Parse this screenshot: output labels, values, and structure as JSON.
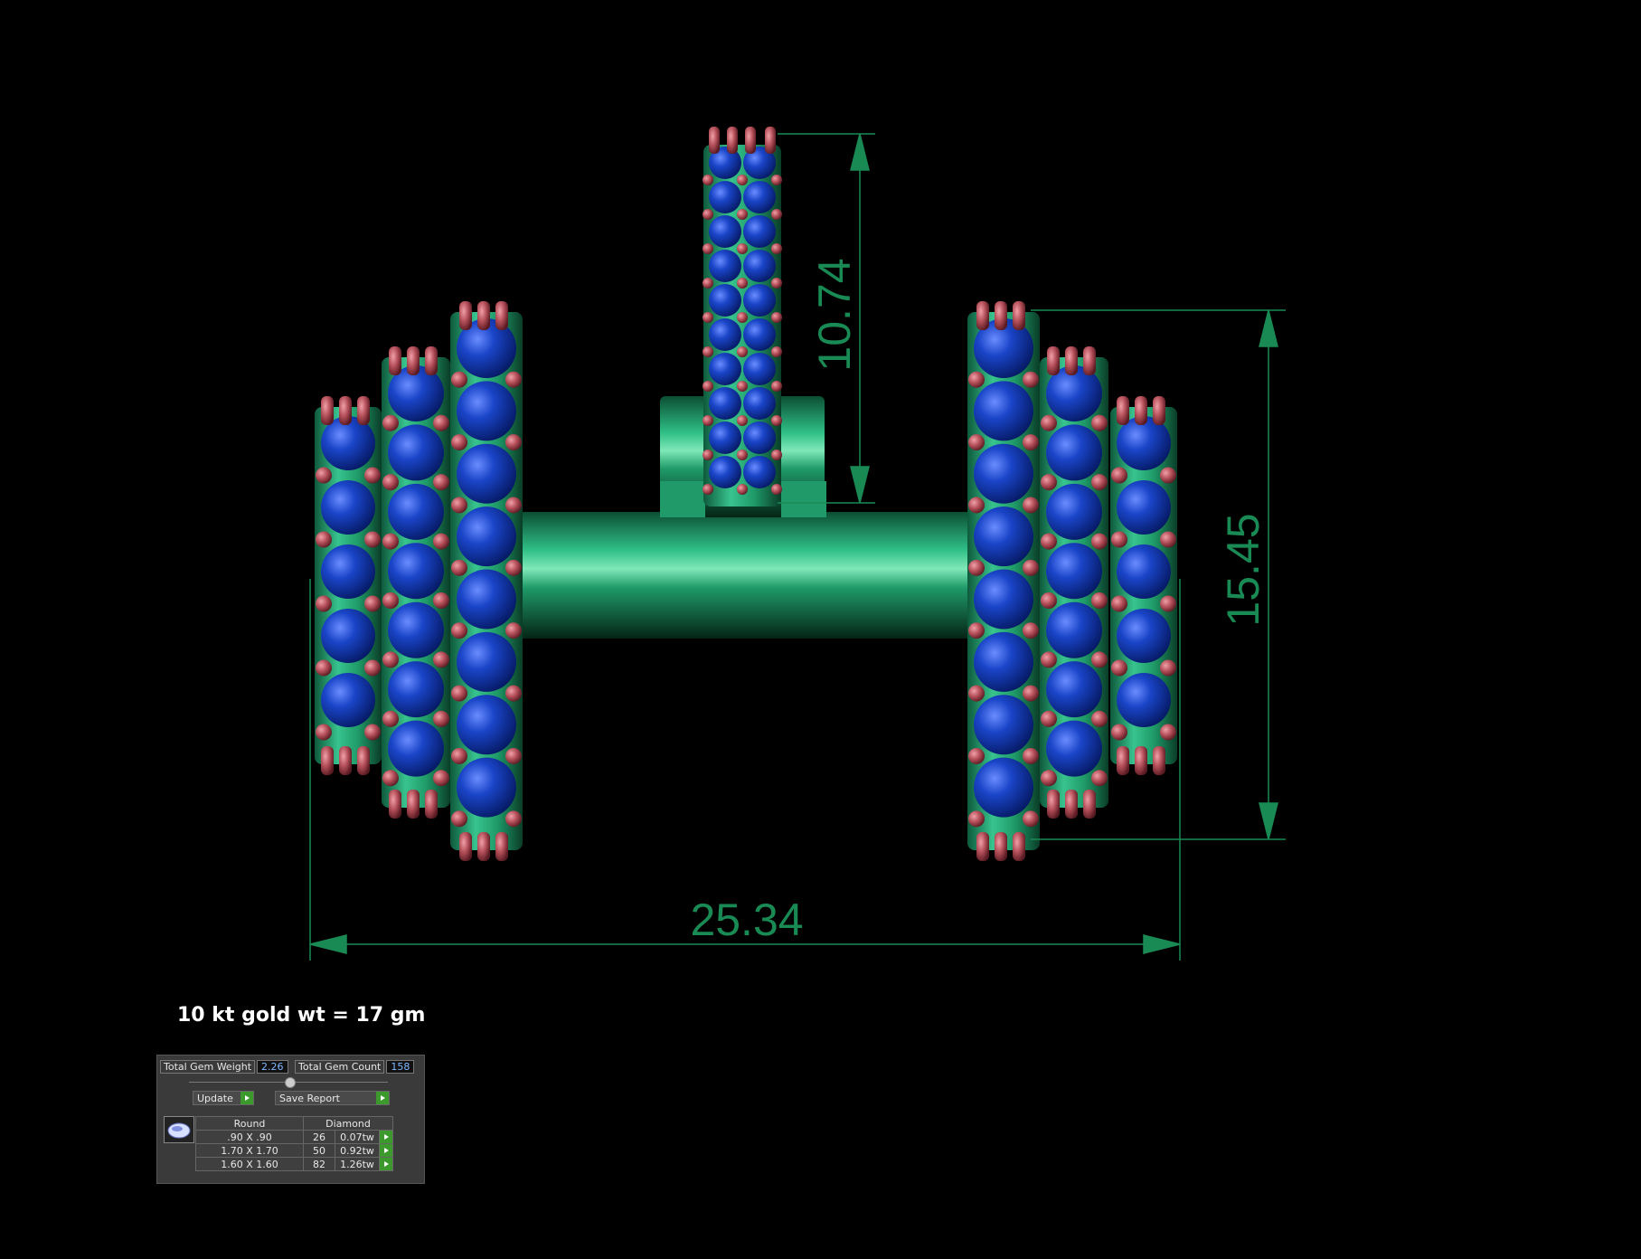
{
  "dimensions": {
    "width": "25.34",
    "height": "15.45",
    "bail_height": "10.74"
  },
  "gold_weight": "10 kt gold wt = 17 gm",
  "panel": {
    "total_gem_weight_label": "Total Gem Weight",
    "total_gem_weight_value": "2.26",
    "total_gem_count_label": "Total Gem Count",
    "total_gem_count_value": "158",
    "update_label": "Update",
    "save_report_label": "Save Report",
    "table": {
      "headers": [
        "Round",
        "Diamond"
      ],
      "rows": [
        {
          "size": ".90 X .90",
          "count": "26",
          "weight": "0.07tw"
        },
        {
          "size": "1.70 X 1.70",
          "count": "50",
          "weight": "0.92tw"
        },
        {
          "size": "1.60 X 1.60",
          "count": "82",
          "weight": "1.26tw"
        }
      ]
    }
  },
  "colors": {
    "metal": "#1f9a68",
    "gem": "#1238b0",
    "prong": "#b5505a",
    "dimension": "#1a8a55"
  }
}
